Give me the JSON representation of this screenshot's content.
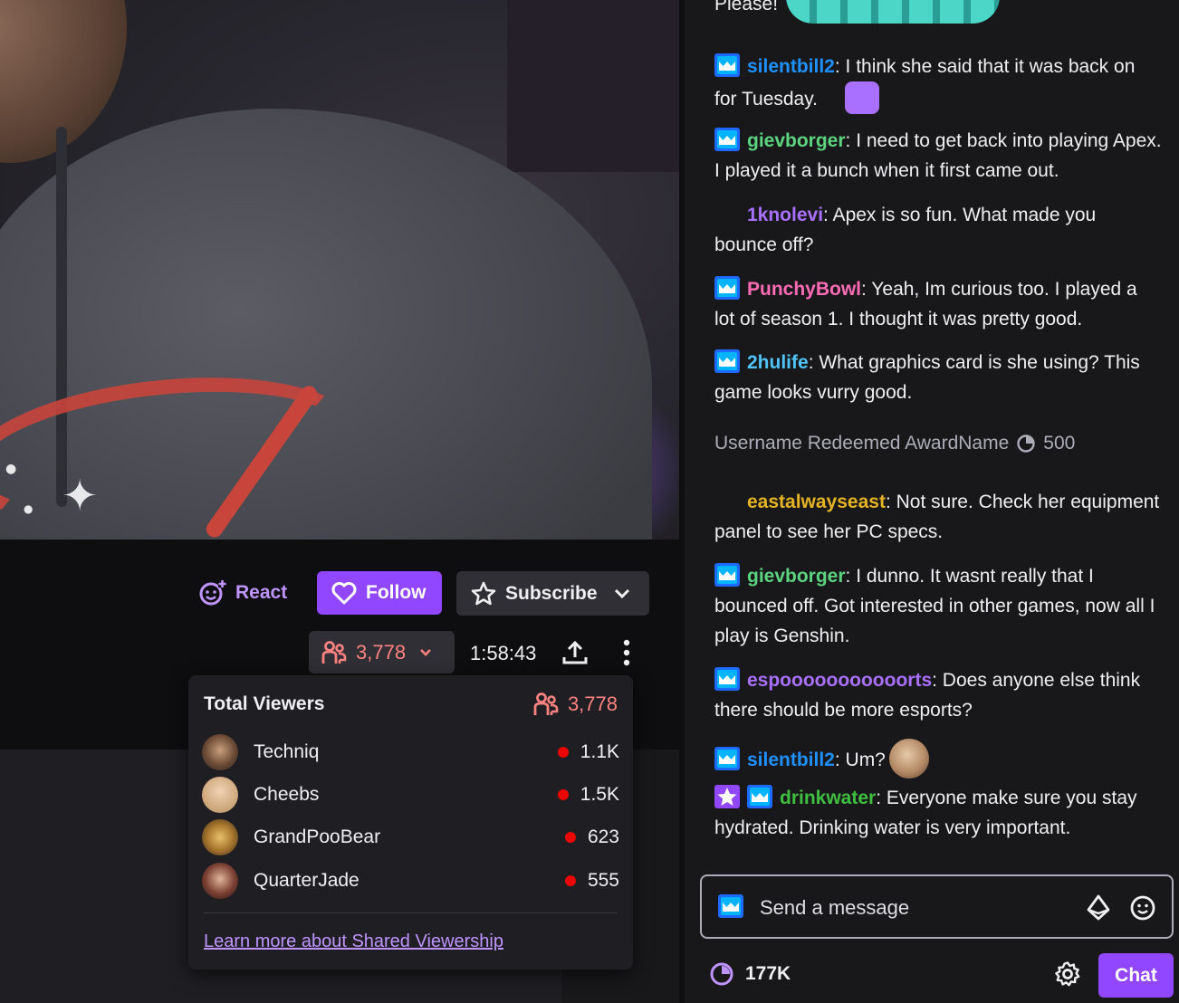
{
  "actions": {
    "react_label": "React",
    "follow_label": "Follow",
    "subscribe_label": "Subscribe"
  },
  "stream": {
    "viewer_count": "3,778",
    "uptime": "1:58:43"
  },
  "viewers_popover": {
    "title": "Total Viewers",
    "total": "3,778",
    "rows": [
      {
        "name": "Techniq",
        "count": "1.1K"
      },
      {
        "name": "Cheebs",
        "count": "1.5K"
      },
      {
        "name": "GrandPooBear",
        "count": "623"
      },
      {
        "name": "QuarterJade",
        "count": "555"
      }
    ],
    "learn_more": "Learn more about Shared Viewership"
  },
  "chat": {
    "partial_top": "Please!",
    "messages": [
      {
        "user": "silentbill2",
        "user_color": "#1e90ff",
        "text": ": I think she said that it was back on for Tuesday."
      },
      {
        "user": "gievborger",
        "user_color": "#5bd37f",
        "text": ": I need to get back into playing Apex. I played it a bunch when it first came out."
      },
      {
        "user": "1knolevi",
        "user_color": "#a970ff",
        "text": ": Apex is so fun. What made you bounce off?"
      },
      {
        "user": "PunchyBowl",
        "user_color": "#ff6bb5",
        "text": ": Yeah, Im curious too. I played a lot of season 1. I thought it was pretty good."
      },
      {
        "user": "2hulife",
        "user_color": "#4fc3f7",
        "text": ": What graphics card is she using? This game looks vurry good."
      },
      {
        "user": "eastalwayseast",
        "user_color": "#e6b422",
        "text": ": Not sure. Check her equipment panel to see her PC specs."
      },
      {
        "user": "gievborger",
        "user_color": "#5bd37f",
        "text": ": I dunno. It wasnt really that I bounced off. Got interested in other games, now all I play is Genshin."
      },
      {
        "user": "espooooooooooorts",
        "user_color": "#a970ff",
        "text": ": Does anyone else think there should be more esports?"
      },
      {
        "user": "silentbill2",
        "user_color": "#1e90ff",
        "text": ": Um?"
      },
      {
        "user": "drinkwater",
        "user_color": "#3fbf3f",
        "text": ": Everyone make sure you stay hydrated. Drinking water is very important."
      }
    ],
    "redemption": {
      "text": "Username Redeemed AwardName",
      "cost": "500"
    },
    "input_placeholder": "Send a message",
    "channel_points": "177K",
    "chat_button": "Chat"
  },
  "colors": {
    "brand_purple": "#9147ff",
    "link_purple": "#bf94ff",
    "viewer_red": "#ff8280",
    "live_red": "#eb0400"
  }
}
